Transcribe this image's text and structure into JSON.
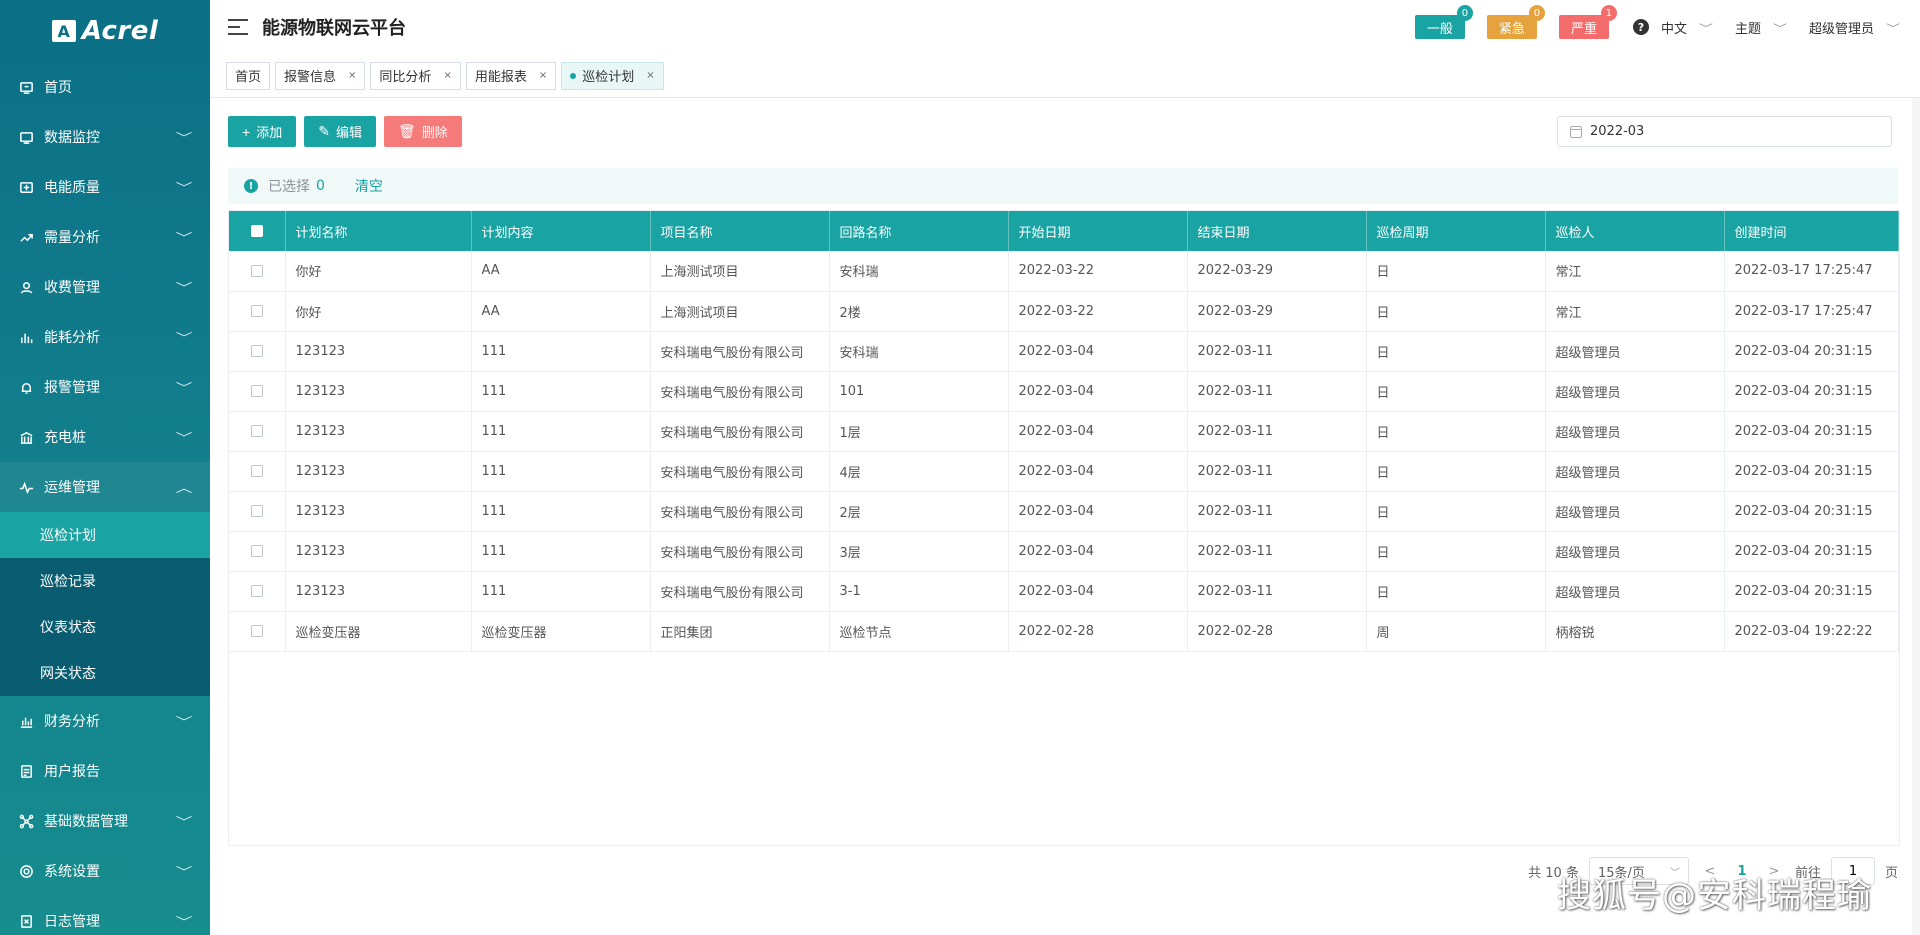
{
  "sidebar": {
    "logo_mark": "A",
    "logo_text": "Acrel",
    "items": [
      {
        "label": "首页",
        "icon": "monitor-icon",
        "has_arrow": false
      },
      {
        "label": "数据监控",
        "icon": "screen-icon",
        "has_arrow": true
      },
      {
        "label": "电能质量",
        "icon": "power-icon",
        "has_arrow": true
      },
      {
        "label": "需量分析",
        "icon": "trend-icon",
        "has_arrow": true
      },
      {
        "label": "收费管理",
        "icon": "user-icon",
        "has_arrow": true
      },
      {
        "label": "能耗分析",
        "icon": "bar-chart-icon",
        "has_arrow": true
      },
      {
        "label": "报警管理",
        "icon": "alarm-icon",
        "has_arrow": true
      },
      {
        "label": "充电桩",
        "icon": "bank-icon",
        "has_arrow": true
      },
      {
        "label": "运维管理",
        "icon": "pulse-icon",
        "has_arrow": true,
        "open": true
      }
    ],
    "submenu": [
      {
        "label": "巡检计划",
        "active": true
      },
      {
        "label": "巡检记录",
        "active": false
      },
      {
        "label": "仪表状态",
        "active": false
      },
      {
        "label": "网关状态",
        "active": false
      }
    ],
    "items_after": [
      {
        "label": "财务分析",
        "icon": "finance-icon",
        "has_arrow": true
      },
      {
        "label": "用户报告",
        "icon": "report-icon",
        "has_arrow": false
      },
      {
        "label": "基础数据管理",
        "icon": "network-icon",
        "has_arrow": true
      },
      {
        "label": "系统设置",
        "icon": "gear-icon",
        "has_arrow": true
      },
      {
        "label": "日志管理",
        "icon": "log-icon",
        "has_arrow": true
      }
    ],
    "arrow_down": "﹀",
    "arrow_up": "︿"
  },
  "header": {
    "title": "能源物联网云平台",
    "alarms": [
      {
        "label": "一般",
        "count": "0",
        "bg": "#1aa3a3",
        "badge_bg": "#1aa3a3"
      },
      {
        "label": "紧急",
        "count": "0",
        "bg": "#e6a23c",
        "badge_bg": "#e6a23c"
      },
      {
        "label": "严重",
        "count": "1",
        "bg": "#f56c6c",
        "badge_bg": "#f56c6c"
      }
    ],
    "help_glyph": "?",
    "language": "中文",
    "theme": "主题",
    "user": "超级管理员"
  },
  "tabs": [
    {
      "label": "首页",
      "closable": false,
      "active": false
    },
    {
      "label": "报警信息",
      "closable": true,
      "active": false
    },
    {
      "label": "同比分析",
      "closable": true,
      "active": false
    },
    {
      "label": "用能报表",
      "closable": true,
      "active": false
    },
    {
      "label": "巡检计划",
      "closable": true,
      "active": true
    }
  ],
  "toolbar": {
    "add_label": "添加",
    "edit_label": "编辑",
    "delete_label": "删除",
    "date_value": "2022-03"
  },
  "selection": {
    "text": "已选择",
    "count": "0",
    "clear_label": "清空"
  },
  "table": {
    "columns": [
      "计划名称",
      "计划内容",
      "项目名称",
      "回路名称",
      "开始日期",
      "结束日期",
      "巡检周期",
      "巡检人",
      "创建时间"
    ],
    "rows": [
      [
        "你好",
        "AA",
        "上海测试项目",
        "安科瑞",
        "2022-03-22",
        "2022-03-29",
        "日",
        "常江",
        "2022-03-17 17:25:47"
      ],
      [
        "你好",
        "AA",
        "上海测试项目",
        "2楼",
        "2022-03-22",
        "2022-03-29",
        "日",
        "常江",
        "2022-03-17 17:25:47"
      ],
      [
        "123123",
        "111",
        "安科瑞电气股份有限公司",
        "安科瑞",
        "2022-03-04",
        "2022-03-11",
        "日",
        "超级管理员",
        "2022-03-04 20:31:15"
      ],
      [
        "123123",
        "111",
        "安科瑞电气股份有限公司",
        "101",
        "2022-03-04",
        "2022-03-11",
        "日",
        "超级管理员",
        "2022-03-04 20:31:15"
      ],
      [
        "123123",
        "111",
        "安科瑞电气股份有限公司",
        "1层",
        "2022-03-04",
        "2022-03-11",
        "日",
        "超级管理员",
        "2022-03-04 20:31:15"
      ],
      [
        "123123",
        "111",
        "安科瑞电气股份有限公司",
        "4层",
        "2022-03-04",
        "2022-03-11",
        "日",
        "超级管理员",
        "2022-03-04 20:31:15"
      ],
      [
        "123123",
        "111",
        "安科瑞电气股份有限公司",
        "2层",
        "2022-03-04",
        "2022-03-11",
        "日",
        "超级管理员",
        "2022-03-04 20:31:15"
      ],
      [
        "123123",
        "111",
        "安科瑞电气股份有限公司",
        "3层",
        "2022-03-04",
        "2022-03-11",
        "日",
        "超级管理员",
        "2022-03-04 20:31:15"
      ],
      [
        "123123",
        "111",
        "安科瑞电气股份有限公司",
        "3-1",
        "2022-03-04",
        "2022-03-11",
        "日",
        "超级管理员",
        "2022-03-04 20:31:15"
      ],
      [
        "巡检变压器",
        "巡检变压器",
        "正阳集团",
        "巡检节点",
        "2022-02-28",
        "2022-02-28",
        "周",
        "柄榕锐",
        "2022-03-04 19:22:22"
      ]
    ]
  },
  "pagination": {
    "total": "共 10 条",
    "page_size": "15条/页",
    "prev": "<",
    "current": "1",
    "next": ">",
    "goto_prefix": "前往",
    "goto_value": "1",
    "goto_suffix": "页"
  },
  "watermark": "搜狐号@安科瑞程瑜"
}
